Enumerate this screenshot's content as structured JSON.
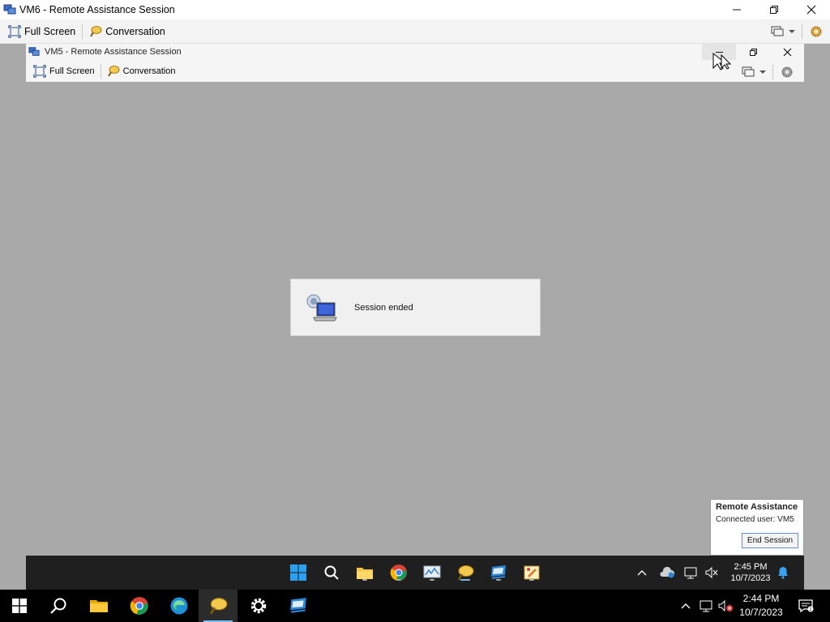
{
  "outer_window": {
    "title": "VM6 - Remote Assistance Session",
    "toolbar": {
      "full_screen_label": "Full Screen",
      "conversation_label": "Conversation"
    }
  },
  "inner_window": {
    "title": "VM5 - Remote Assistance Session",
    "toolbar": {
      "full_screen_label": "Full Screen",
      "conversation_label": "Conversation"
    }
  },
  "dialog": {
    "message": "Session ended"
  },
  "ra_panel": {
    "title": "Remote Assistance",
    "connected_user": "Connected user: VM5",
    "end_session_label": "End Session"
  },
  "inner_taskbar": {
    "time": "2:45 PM",
    "date": "10/7/2023",
    "apps": [
      "start-icon",
      "search-icon",
      "file-explorer-icon",
      "chrome-icon",
      "performance-monitor-icon",
      "remote-assistance-icon",
      "remote-desktop-icon",
      "paint-icon"
    ]
  },
  "taskbar": {
    "time": "2:44 PM",
    "date": "10/7/2023",
    "apps": [
      "start-icon",
      "search-icon",
      "file-explorer-icon",
      "chrome-icon",
      "edge-icon",
      "remote-assistance-icon",
      "settings-icon",
      "remote-desktop-icon"
    ]
  },
  "colors": {
    "desktop": "#a9a9a9",
    "taskbar": "#000000",
    "accent": "#76b9ed"
  }
}
